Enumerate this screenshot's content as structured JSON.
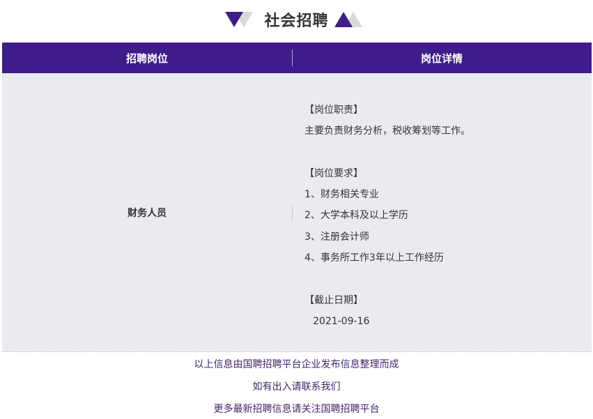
{
  "header": {
    "title": "社会招聘",
    "colors": {
      "accent_purple": "#3e1c8a",
      "triangle_gray": "#d9d9d9"
    }
  },
  "table": {
    "columns": [
      "招聘岗位",
      "岗位详情"
    ],
    "rows": [
      {
        "position": "财务人员",
        "details": {
          "duty_title": "【岗位职责】",
          "duty_text": "主要负责财务分析，税收筹划等工作。",
          "req_title": "【岗位要求】",
          "requirements": [
            "1、财务相关专业",
            "2、大学本科及以上学历",
            "3、注册会计师",
            "4、事务所工作3年以上工作经历"
          ],
          "deadline_title": "【截止日期】",
          "deadline": "2021-09-16"
        }
      }
    ]
  },
  "footer": {
    "lines": [
      "以上信息由国聘招聘平台企业发布信息整理而成",
      "如有出入请联系我们",
      "更多最新招聘信息请关注国聘招聘平台"
    ]
  }
}
